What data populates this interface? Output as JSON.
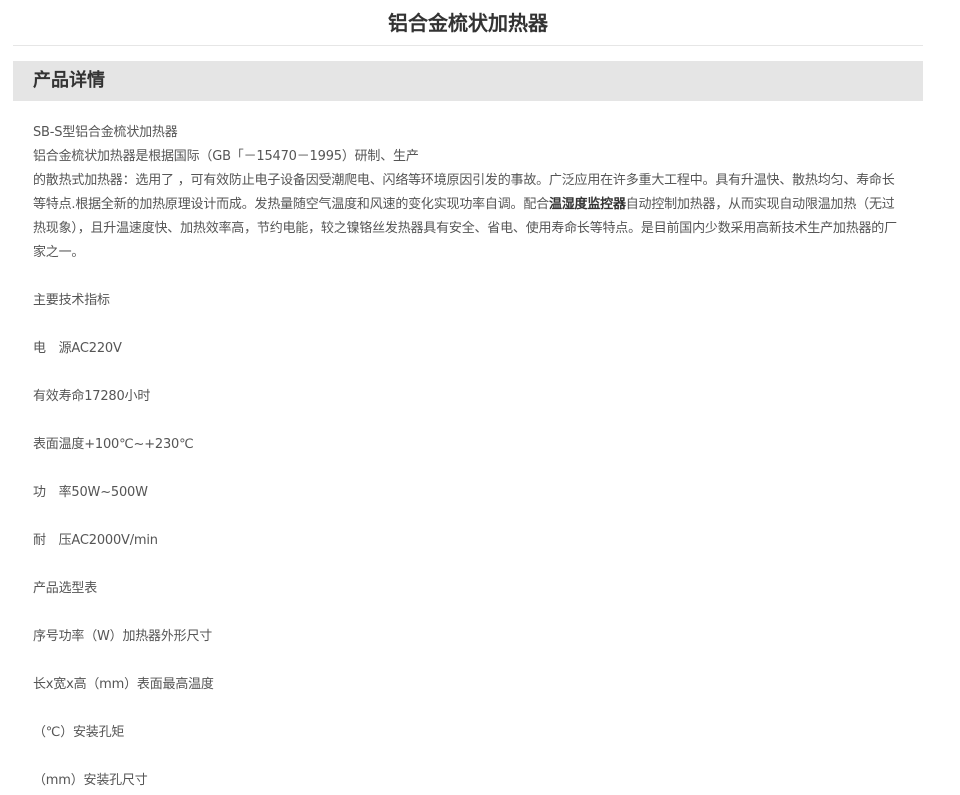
{
  "page": {
    "title": "铝合金梳状加热器"
  },
  "section": {
    "title": "产品详情"
  },
  "intro": {
    "model": "SB-S型铝合金梳状加热器",
    "line2": "铝合金梳状加热器是根据国际（GB「－15470－1995）研制、生产",
    "para_before_bold": "的散热式加热器：选用了  ，可有效防止电子设备因受潮爬电、闪络等环境原因引发的事故。广泛应用在许多重大工程中。具有升温快、散热均匀、寿命长等特点.根据全新的加热原理设计而成。发热量随空气温度和风速的变化实现功率自调。配合",
    "para_bold": "温湿度监控器",
    "para_after_bold": "自动控制加热器，从而实现自动限温加热（无过热现象），且升温速度快、加热效率高，节约电能，较之镍铬丝发热器具有安全、省电、使用寿命长等特点。是目前国内少数采用高新技术生产加热器的厂家之一。"
  },
  "specs": {
    "heading": "主要技术指标",
    "power_supply": "电　源AC220V",
    "lifetime": "有效寿命17280小时",
    "surface_temp": "表面温度+100℃~+230℃",
    "wattage": "功　率50W~500W",
    "withstand_voltage": "耐　压AC2000V/min"
  },
  "selection": {
    "heading": "产品选型表",
    "row1": "序号功率（W）加热器外形尺寸",
    "row2": "长x宽x高（mm）表面最高温度",
    "row3": "（℃）安装孔矩",
    "row4": "（mm）安装孔尺寸"
  }
}
